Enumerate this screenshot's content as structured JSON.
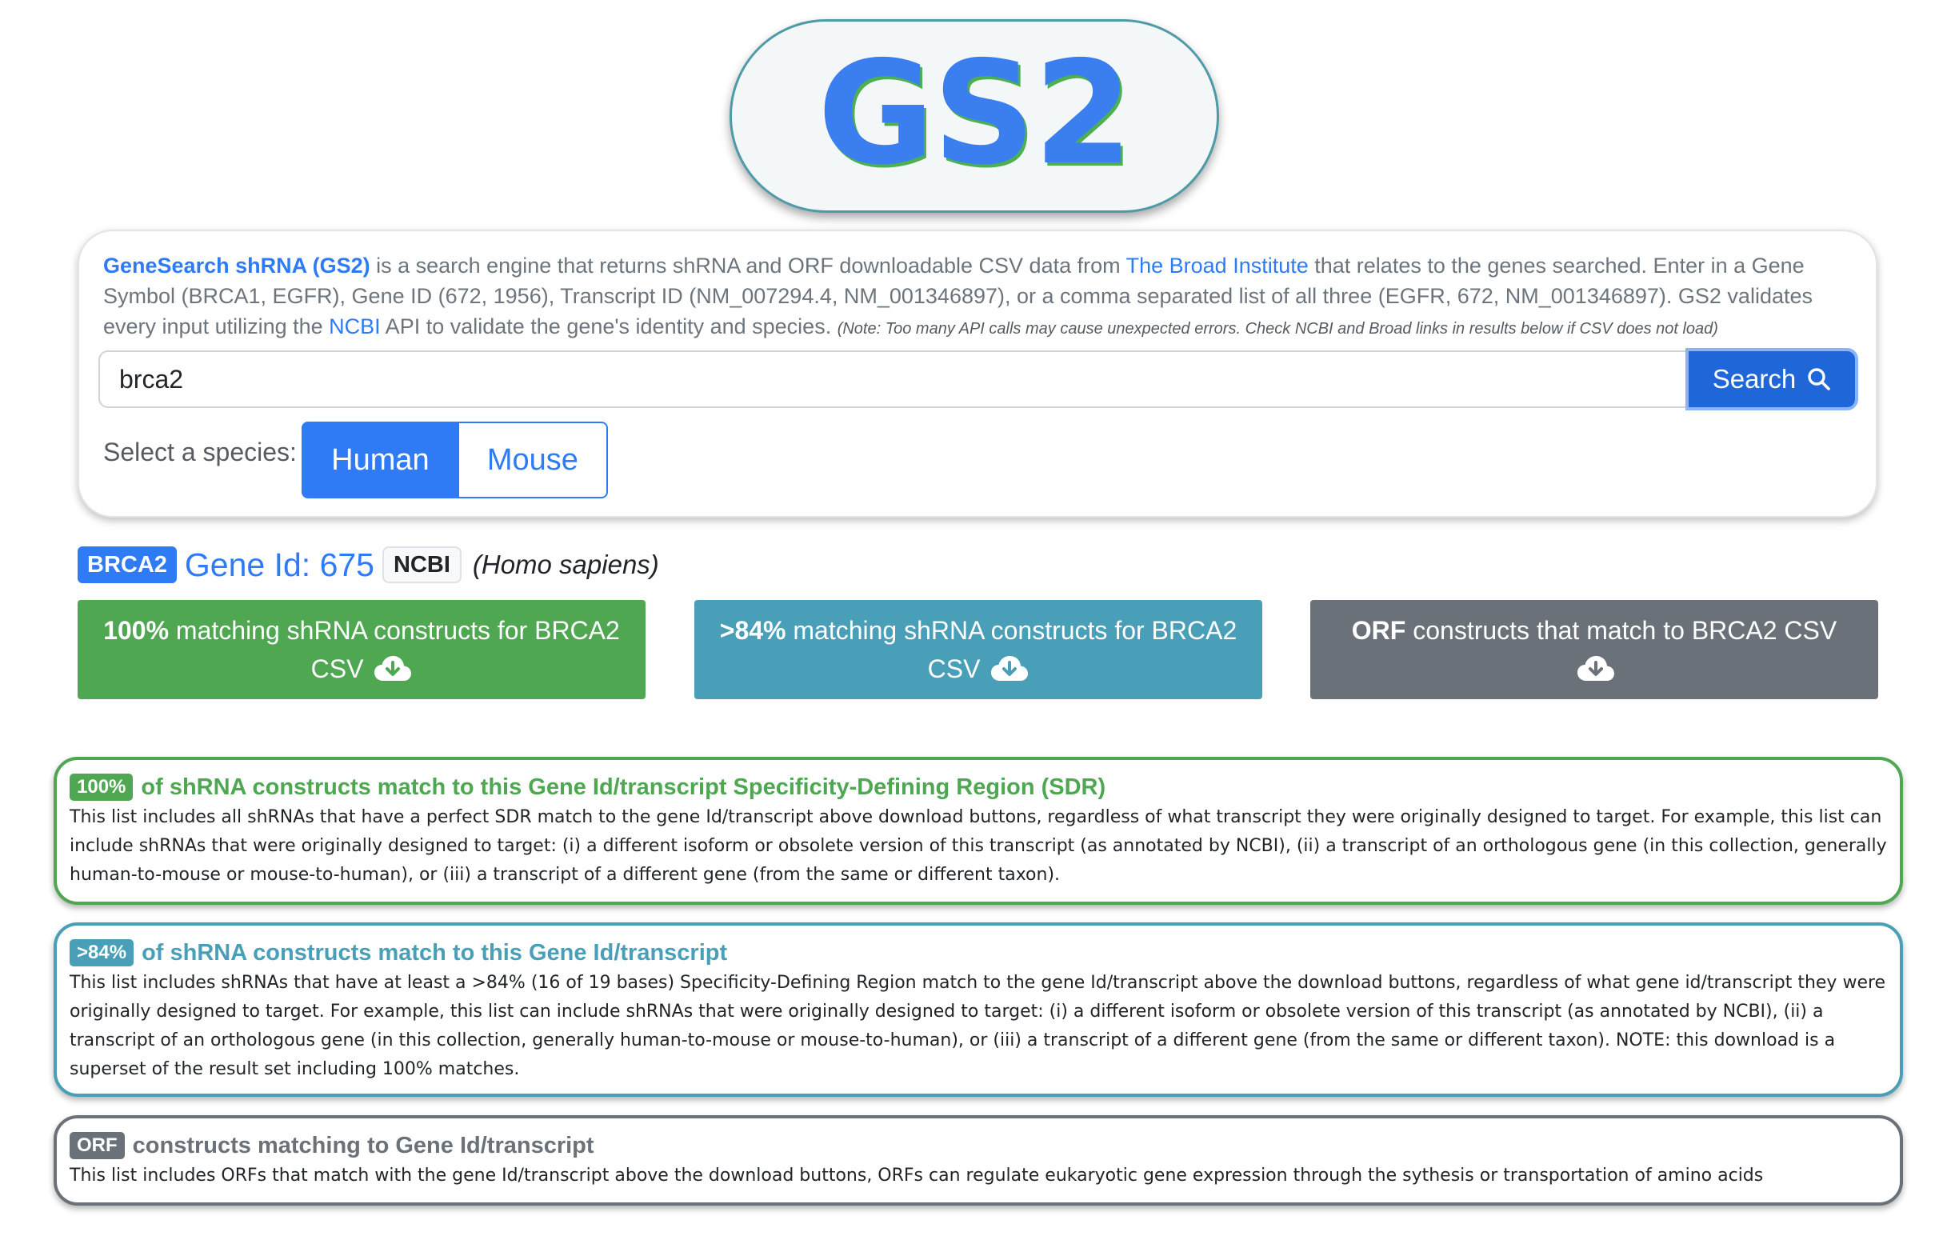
{
  "logo": {
    "text": "GS2"
  },
  "intro": {
    "brand_link": "GeneSearch shRNA (GS2)",
    "text_1": " is a search engine that returns shRNA and ORF downloadable CSV data from ",
    "broad_link": "The Broad Institute",
    "text_2": " that relates to the genes searched. Enter in a Gene Symbol (BRCA1, EGFR), Gene ID (672, 1956), Transcript ID (NM_007294.4, NM_001346897), or a comma separated list of all three (EGFR, 672, NM_001346897). GS2 validates every input utilizing the ",
    "ncbi_link": "NCBI",
    "text_3": " API to validate the gene's identity and species. ",
    "note": "(Note: Too many API calls may cause unexpected errors. Check NCBI and Broad links in results below if CSV does not load)"
  },
  "search": {
    "value": "brca2",
    "button_label": "Search",
    "button_icon": "magnifier-icon"
  },
  "species": {
    "label": "Select a species:",
    "options": [
      "Human",
      "Mouse"
    ],
    "selected": "Human"
  },
  "result": {
    "gene_symbol": "BRCA2",
    "gene_id_label": "Gene Id: 675",
    "ncbi_label": "NCBI",
    "species_name": "(Homo sapiens)"
  },
  "downloads": {
    "match100": {
      "bold": "100%",
      "text": " matching shRNA constructs for BRCA2 CSV",
      "color": "#4fa752"
    },
    "match84": {
      "bold": ">84%",
      "text": " matching shRNA constructs for BRCA2 CSV",
      "color": "#4a9fb8"
    },
    "orf": {
      "bold": "ORF",
      "text": " constructs that match to BRCA2 CSV",
      "color": "#6b7178"
    },
    "icon": "cloud-download-icon"
  },
  "panels": {
    "match100": {
      "badge": "100%",
      "title": "of shRNA constructs match to this Gene Id/transcript Specificity-Defining Region (SDR)",
      "body": "This list includes all shRNAs that have a perfect SDR match to the gene Id/transcript above download buttons, regardless of what transcript they were originally designed to target. For example, this list can include shRNAs that were originally designed to target: (i) a different isoform or obsolete version of this transcript (as annotated by NCBI), (ii) a transcript of an orthologous gene (in this collection, generally human-to-mouse or mouse-to-human), or (iii) a transcript of a different gene (from the same or different taxon)."
    },
    "match84": {
      "badge": ">84%",
      "title": "of shRNA constructs match to this Gene Id/transcript",
      "body": "This list includes shRNAs that have at least a >84% (16 of 19 bases) Specificity-Defining Region match to the gene Id/transcript above the download buttons, regardless of what gene id/transcript they were originally designed to target. For example, this list can include shRNAs that were originally designed to target: (i) a different isoform or obsolete version of this transcript (as annotated by NCBI), (ii) a transcript of an orthologous gene (in this collection, generally human-to-mouse or mouse-to-human), or (iii) a transcript of a different gene (from the same or different taxon). NOTE: this download is a superset of the result set including 100% matches."
    },
    "orf": {
      "badge": "ORF",
      "title": "constructs matching to Gene Id/transcript",
      "body": "This list includes ORFs that match with the gene Id/transcript above the download buttons, ORFs can regulate eukaryotic gene expression through the sythesis or transportation of amino acids"
    }
  },
  "colors": {
    "primary": "#2f7bf5",
    "success": "#4fa752",
    "info": "#4a9fb8",
    "secondary": "#6b7178"
  }
}
